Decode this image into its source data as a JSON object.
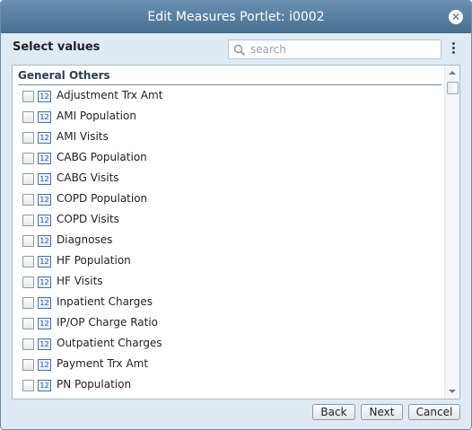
{
  "dialog": {
    "title": "Edit Measures Portlet: i0002",
    "close_glyph": "✕"
  },
  "toolbar": {
    "select_label": "Select values",
    "search_placeholder": "search"
  },
  "group": {
    "header": "General Others",
    "type_icon": "12",
    "items": [
      {
        "label": "Adjustment Trx Amt",
        "checked": false
      },
      {
        "label": "AMI Population",
        "checked": false
      },
      {
        "label": "AMI Visits",
        "checked": false
      },
      {
        "label": "CABG Population",
        "checked": false
      },
      {
        "label": "CABG Visits",
        "checked": false
      },
      {
        "label": "COPD Population",
        "checked": false
      },
      {
        "label": "COPD Visits",
        "checked": false
      },
      {
        "label": "Diagnoses",
        "checked": false
      },
      {
        "label": "HF Population",
        "checked": false
      },
      {
        "label": "HF Visits",
        "checked": false
      },
      {
        "label": "Inpatient Charges",
        "checked": false
      },
      {
        "label": "IP/OP Charge Ratio",
        "checked": false
      },
      {
        "label": "Outpatient Charges",
        "checked": false
      },
      {
        "label": "Payment Trx Amt",
        "checked": false
      },
      {
        "label": "PN Population",
        "checked": false
      }
    ]
  },
  "footer": {
    "back_label": "Back",
    "next_label": "Next",
    "cancel_label": "Cancel"
  },
  "colors": {
    "titlebar": "#4a7191",
    "dialog_bg": "#dfeaf3",
    "number_icon": "#2d4f82"
  }
}
